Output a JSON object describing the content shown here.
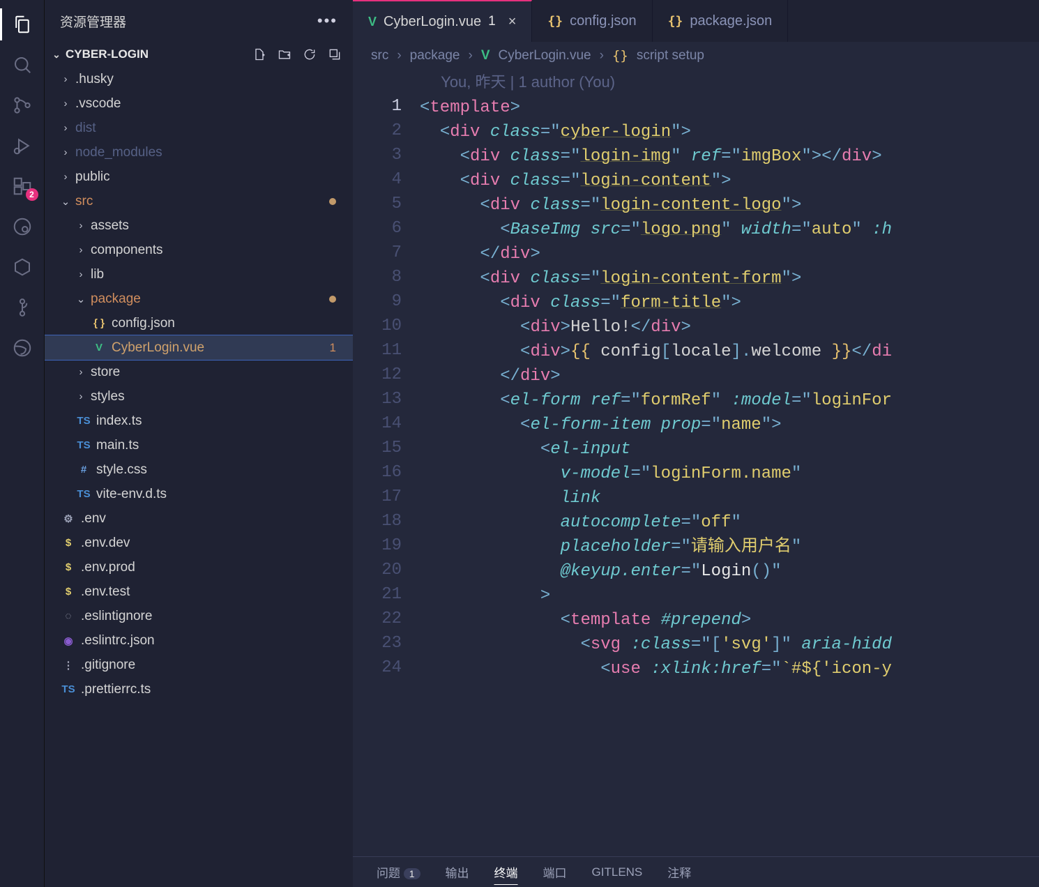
{
  "sidebar": {
    "title": "资源管理器",
    "section": "CYBER-LOGIN",
    "tree": [
      {
        "type": "folder",
        "label": ".husky",
        "indent": 0
      },
      {
        "type": "folder",
        "label": ".vscode",
        "indent": 0
      },
      {
        "type": "folder",
        "label": "dist",
        "indent": 0,
        "dim": true
      },
      {
        "type": "folder",
        "label": "node_modules",
        "indent": 0,
        "dim": true
      },
      {
        "type": "folder",
        "label": "public",
        "indent": 0
      },
      {
        "type": "folder",
        "label": "src",
        "indent": 0,
        "open": true,
        "dot": true
      },
      {
        "type": "folder",
        "label": "assets",
        "indent": 1
      },
      {
        "type": "folder",
        "label": "components",
        "indent": 1
      },
      {
        "type": "folder",
        "label": "lib",
        "indent": 1
      },
      {
        "type": "folder",
        "label": "package",
        "indent": 1,
        "open": true,
        "dot": true
      },
      {
        "type": "file",
        "label": "config.json",
        "indent": 2,
        "ico": "json",
        "icoText": "{ }"
      },
      {
        "type": "file",
        "label": "CyberLogin.vue",
        "indent": 2,
        "ico": "vue",
        "icoText": "V",
        "selected": true,
        "count": "1"
      },
      {
        "type": "folder",
        "label": "store",
        "indent": 1
      },
      {
        "type": "folder",
        "label": "styles",
        "indent": 1
      },
      {
        "type": "file",
        "label": "index.ts",
        "indent": 1,
        "ico": "ts",
        "icoText": "TS"
      },
      {
        "type": "file",
        "label": "main.ts",
        "indent": 1,
        "ico": "ts",
        "icoText": "TS"
      },
      {
        "type": "file",
        "label": "style.css",
        "indent": 1,
        "ico": "css",
        "icoText": "#"
      },
      {
        "type": "file",
        "label": "vite-env.d.ts",
        "indent": 1,
        "ico": "ts",
        "icoText": "TS"
      },
      {
        "type": "file",
        "label": ".env",
        "indent": 0,
        "ico": "gear",
        "icoText": "⚙"
      },
      {
        "type": "file",
        "label": ".env.dev",
        "indent": 0,
        "ico": "dollar",
        "icoText": "$"
      },
      {
        "type": "file",
        "label": ".env.prod",
        "indent": 0,
        "ico": "dollar",
        "icoText": "$"
      },
      {
        "type": "file",
        "label": ".env.test",
        "indent": 0,
        "ico": "dollar",
        "icoText": "$"
      },
      {
        "type": "file",
        "label": ".eslintignore",
        "indent": 0,
        "ico": "gray",
        "icoText": "◌"
      },
      {
        "type": "file",
        "label": ".eslintrc.json",
        "indent": 0,
        "ico": "edge",
        "icoText": "◉"
      },
      {
        "type": "file",
        "label": ".gitignore",
        "indent": 0,
        "ico": "gray",
        "icoText": "⋮"
      },
      {
        "type": "file",
        "label": ".prettierrc.ts",
        "indent": 0,
        "ico": "ts",
        "icoText": "TS"
      }
    ]
  },
  "tabs": [
    {
      "ico": "vue",
      "icoText": "V",
      "label": "CyberLogin.vue",
      "mod": "1",
      "active": true,
      "close": true
    },
    {
      "ico": "brace",
      "icoText": "{}",
      "label": "config.json"
    },
    {
      "ico": "brace",
      "icoText": "{}",
      "label": "package.json"
    }
  ],
  "breadcrumbs": [
    "src",
    "package",
    "CyberLogin.vue",
    "script setup"
  ],
  "gitlens": "You, 昨天 | 1 author (You)",
  "lineCount": 24,
  "activeLine": 1,
  "panelTabs": {
    "problems": "问题",
    "problemsCount": "1",
    "output": "输出",
    "terminal": "终端",
    "ports": "端口",
    "gitlens": "GITLENS",
    "comments": "注释"
  }
}
